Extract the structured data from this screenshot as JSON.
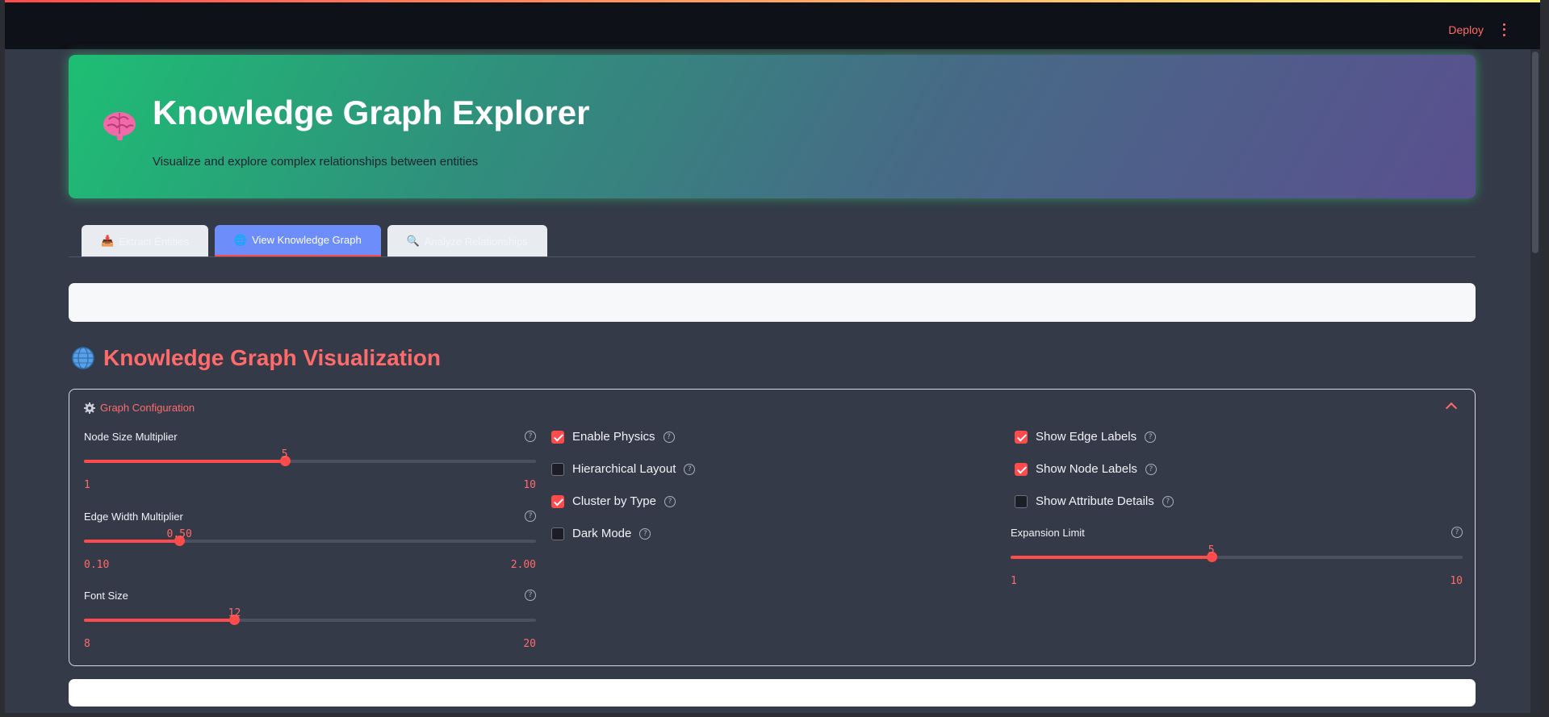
{
  "topbar": {
    "deploy_label": "Deploy",
    "menu_icon": "kebab-menu-icon"
  },
  "hero": {
    "icon": "brain-icon",
    "title": "Knowledge Graph Explorer",
    "subtitle": "Visualize and explore complex relationships between entities"
  },
  "tabs": [
    {
      "icon": "inbox-tray-icon",
      "label": "Extract Entities",
      "active": false
    },
    {
      "icon": "globe-icon",
      "label": "View Knowledge Graph",
      "active": true
    },
    {
      "icon": "magnifier-icon",
      "label": "Analyze Relationships",
      "active": false
    }
  ],
  "section": {
    "icon": "globe-icon",
    "title": "Knowledge Graph Visualization"
  },
  "config": {
    "header": "Graph Configuration",
    "sliders": [
      {
        "label": "Node Size Multiplier",
        "value": "5",
        "min": "1",
        "max": "10",
        "fraction": 0.444
      },
      {
        "label": "Edge Width Multiplier",
        "value": "0.50",
        "min": "0.10",
        "max": "2.00",
        "fraction": 0.211
      },
      {
        "label": "Font Size",
        "value": "12",
        "min": "8",
        "max": "20",
        "fraction": 0.333
      }
    ],
    "checks_mid": [
      {
        "label": "Enable Physics",
        "checked": true
      },
      {
        "label": "Hierarchical Layout",
        "checked": false
      },
      {
        "label": "Cluster by Type",
        "checked": true
      },
      {
        "label": "Dark Mode",
        "checked": false
      }
    ],
    "checks_right": [
      {
        "label": "Show Edge Labels",
        "checked": true
      },
      {
        "label": "Show Node Labels",
        "checked": true
      },
      {
        "label": "Show Attribute Details",
        "checked": false
      }
    ],
    "expansion": {
      "label": "Expansion Limit",
      "value": "5",
      "min": "1",
      "max": "10",
      "fraction": 0.444
    }
  },
  "colors": {
    "accent": "#ff4b4b",
    "tab_active": "#6c8dfa",
    "background": "#343a48"
  }
}
